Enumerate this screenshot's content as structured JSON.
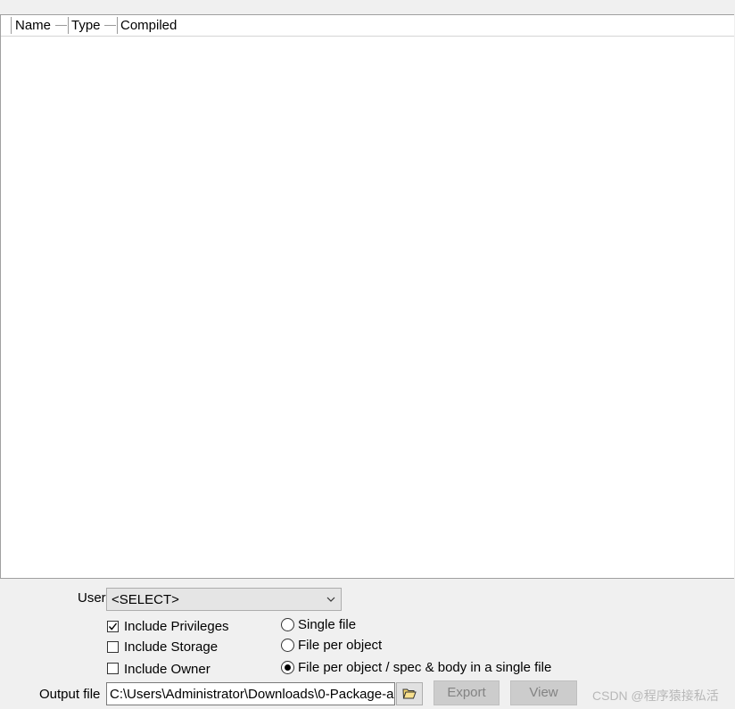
{
  "object_list": {
    "columns": [
      "Name",
      "Type",
      "Compiled"
    ],
    "rows": []
  },
  "user": {
    "label": "User",
    "selected": "<SELECT>"
  },
  "options": {
    "include_privileges": {
      "label": "Include Privileges",
      "checked": true
    },
    "include_storage": {
      "label": "Include Storage",
      "checked": false
    },
    "include_owner": {
      "label": "Include Owner",
      "checked": false
    }
  },
  "file_mode": {
    "single_file": {
      "label": "Single file",
      "selected": false
    },
    "file_per_object": {
      "label": "File per object",
      "selected": false
    },
    "file_per_object_spec_body": {
      "label": "File per object / spec & body in a single file",
      "selected": true
    }
  },
  "output": {
    "label": "Output file",
    "value": "C:\\Users\\Administrator\\Downloads\\0-Package-a"
  },
  "buttons": {
    "export": "Export",
    "view": "View"
  },
  "icons": {
    "chevron": "chevron-down-icon",
    "folder": "folder-open-icon"
  },
  "watermark": "CSDN @程序猿接私活"
}
